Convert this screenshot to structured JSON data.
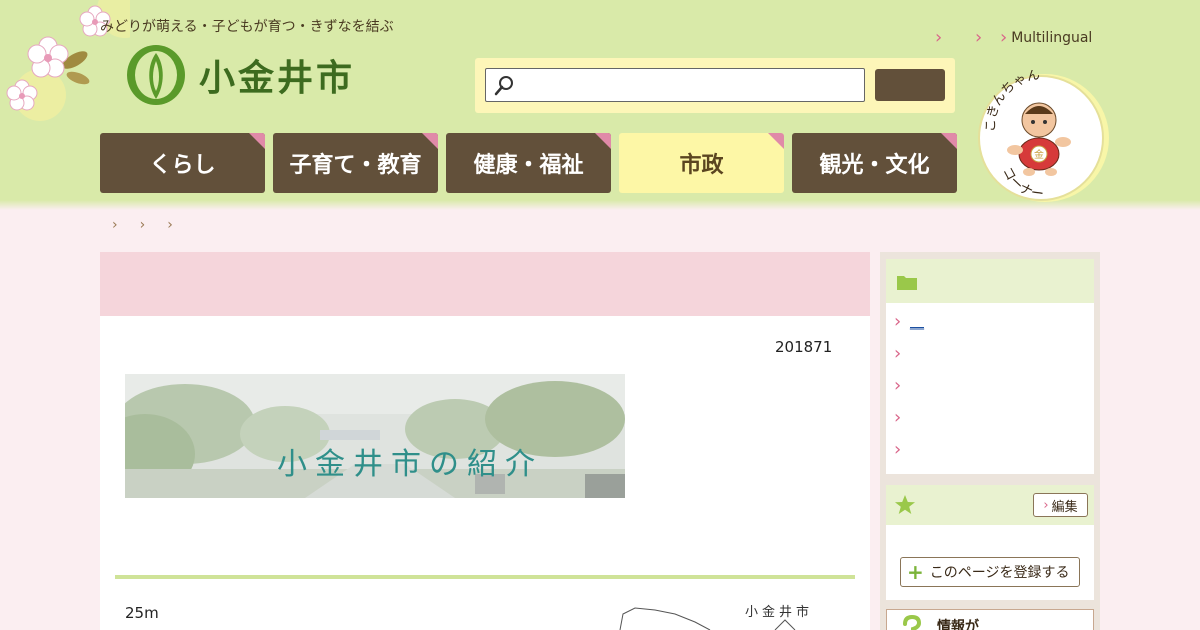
{
  "header": {
    "tagline": "みどりが萌える・子どもが育つ・きずなを結ぶ",
    "city_name": "小金井市",
    "utility_links": [
      "",
      "",
      "Multilingual"
    ],
    "search": {
      "placeholder": "",
      "button_label": ""
    },
    "nav": [
      {
        "label": "くらし",
        "active": false
      },
      {
        "label": "子育て・教育",
        "active": false
      },
      {
        "label": "健康・福祉",
        "active": false
      },
      {
        "label": "市政",
        "active": true
      },
      {
        "label": "観光・文化",
        "active": false
      }
    ],
    "mascot_text_top": "こきんちゃん",
    "mascot_text_bottom": "コーナー",
    "mascot_badge": "金"
  },
  "breadcrumb": [
    "",
    "",
    ""
  ],
  "main": {
    "title": "",
    "date": "201871",
    "banner_text": "小金井市の紹介",
    "distance": "25m",
    "map_label": "小金井市"
  },
  "sidebar": {
    "related_links": [
      "__",
      "",
      "",
      "",
      ""
    ],
    "edit_label": "編集",
    "register_label": "このページを登録する",
    "info_label": "情報が"
  },
  "colors": {
    "header_bg": "#d9eaa9",
    "nav_bg": "#62503a",
    "nav_active_bg": "#fdf7a6",
    "accent_pink": "#d9668a",
    "title_bar": "#f5d5db"
  }
}
